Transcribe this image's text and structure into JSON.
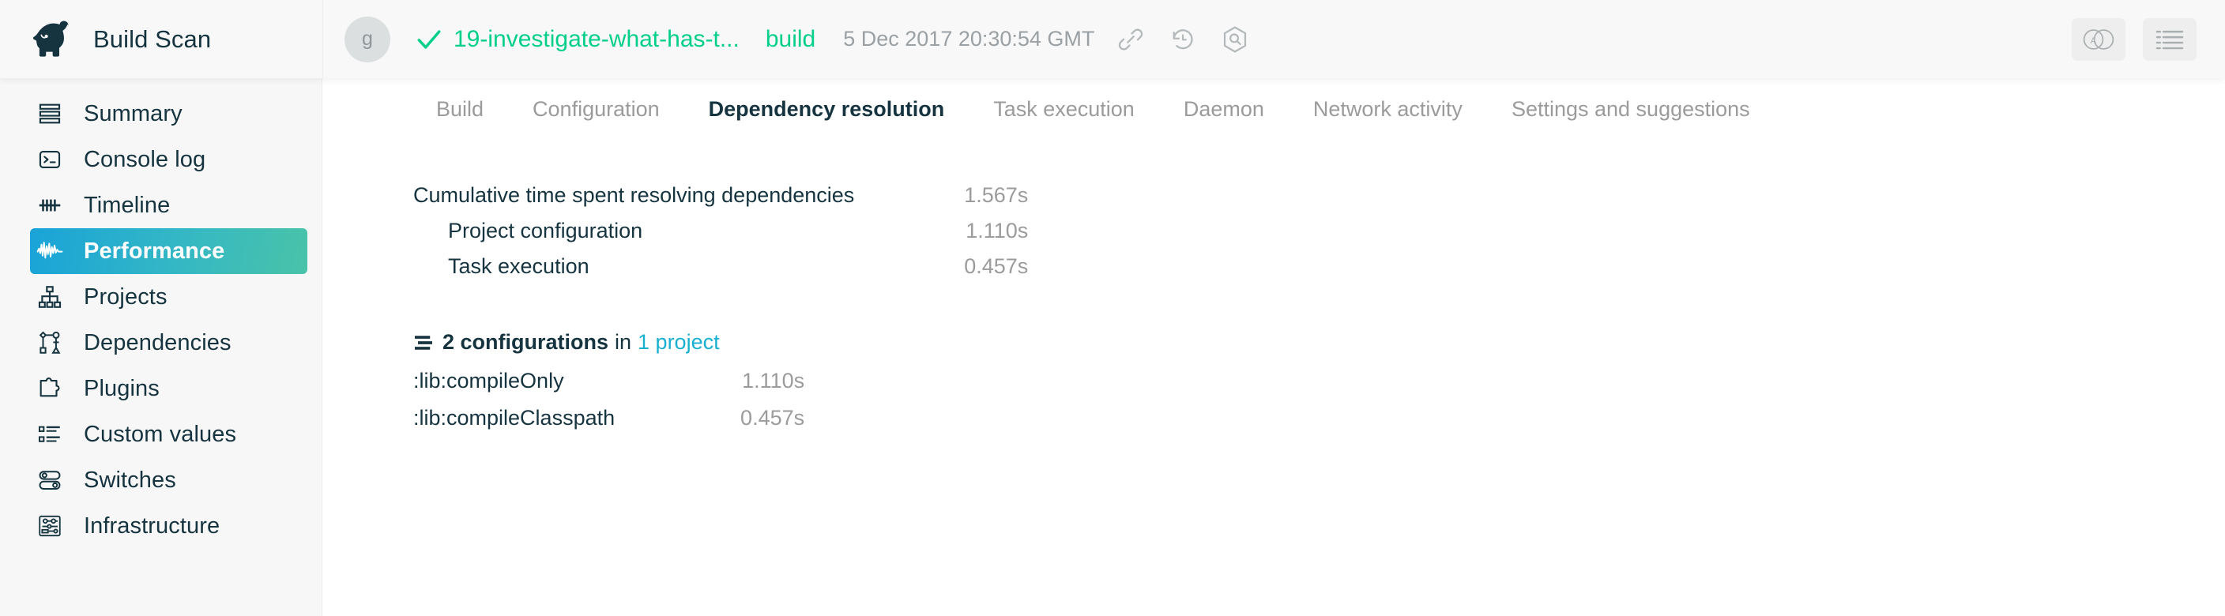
{
  "header": {
    "brand": "Build Scan",
    "logo_icon": "gradle-elephant-logo",
    "avatar_initial": "g",
    "status_icon": "checkmark-icon",
    "scan_title": "19-investigate-what-has-t...",
    "scan_task": "build",
    "timestamp": "5 Dec 2017 20:30:54 GMT",
    "icons": [
      {
        "name": "link-icon"
      },
      {
        "name": "history-icon"
      },
      {
        "name": "search-hex-icon"
      }
    ],
    "tools": [
      {
        "name": "compare-venn-icon"
      },
      {
        "name": "list-menu-icon"
      }
    ],
    "accent_green": "#00cf8a",
    "link_teal": "#18b0d0"
  },
  "sidebar": {
    "items": [
      {
        "label": "Summary",
        "icon": "summary-icon",
        "active": false
      },
      {
        "label": "Console log",
        "icon": "console-icon",
        "active": false
      },
      {
        "label": "Timeline",
        "icon": "timeline-icon",
        "active": false
      },
      {
        "label": "Performance",
        "icon": "performance-icon",
        "active": true
      },
      {
        "label": "Projects",
        "icon": "projects-icon",
        "active": false
      },
      {
        "label": "Dependencies",
        "icon": "dependencies-icon",
        "active": false
      },
      {
        "label": "Plugins",
        "icon": "plugins-icon",
        "active": false
      },
      {
        "label": "Custom values",
        "icon": "custom-values-icon",
        "active": false
      },
      {
        "label": "Switches",
        "icon": "switches-icon",
        "active": false
      },
      {
        "label": "Infrastructure",
        "icon": "infrastructure-icon",
        "active": false
      }
    ]
  },
  "main": {
    "tabs": [
      {
        "label": "Build",
        "active": false
      },
      {
        "label": "Configuration",
        "active": false
      },
      {
        "label": "Dependency resolution",
        "active": true
      },
      {
        "label": "Task execution",
        "active": false
      },
      {
        "label": "Daemon",
        "active": false
      },
      {
        "label": "Network activity",
        "active": false
      },
      {
        "label": "Settings and suggestions",
        "active": false
      }
    ],
    "cumulative": {
      "rows": [
        {
          "label": "Cumulative time spent resolving dependencies",
          "value": "1.567s",
          "indent": false
        },
        {
          "label": "Project configuration",
          "value": "1.110s",
          "indent": true
        },
        {
          "label": "Task execution",
          "value": "0.457s",
          "indent": true
        }
      ]
    },
    "configurations": {
      "icon": "lines-icon",
      "count_label": "2 configurations",
      "in_label": "in",
      "project_link": "1 project",
      "rows": [
        {
          "label": ":lib:compileOnly",
          "value": "1.110s"
        },
        {
          "label": ":lib:compileClasspath",
          "value": "0.457s"
        }
      ]
    }
  }
}
